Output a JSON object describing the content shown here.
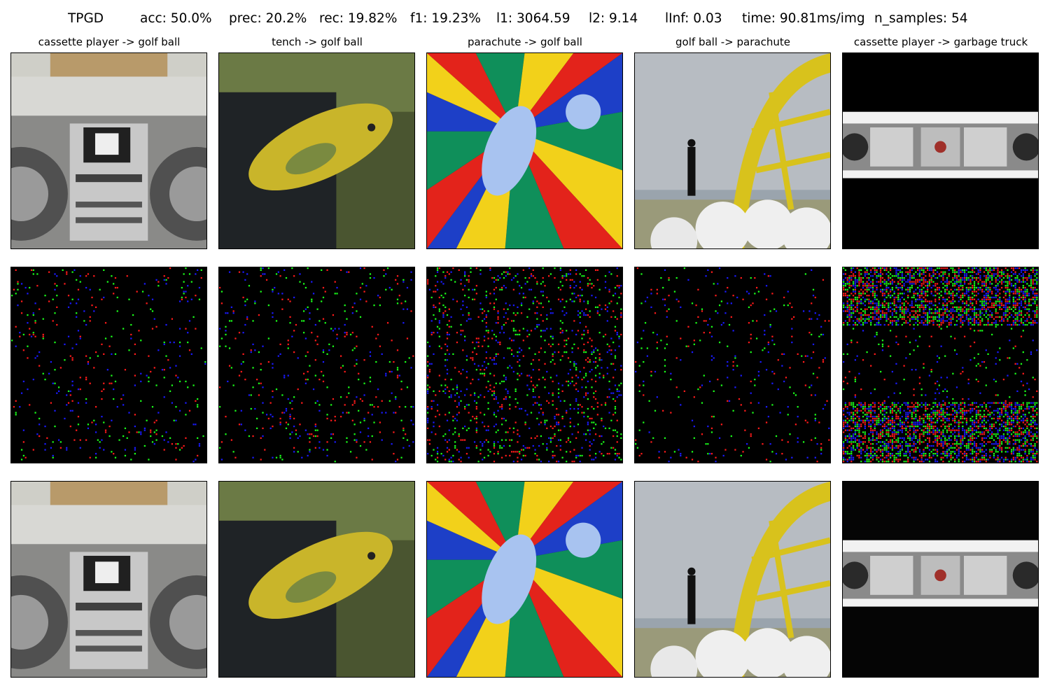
{
  "header": {
    "method": "TPGD",
    "acc": "acc: 50.0%",
    "prec": "prec: 20.2%",
    "rec": "rec: 19.82%",
    "f1": "f1: 19.23%",
    "l1": "l1: 3064.59",
    "l2": "l2: 9.14",
    "linf": "lInf: 0.03",
    "time": "time: 90.81ms/img",
    "n_samples": "n_samples: 54"
  },
  "columns": [
    {
      "title": "cassette player -> golf ball",
      "subject": "boombox-image"
    },
    {
      "title": "tench -> golf ball",
      "subject": "fish-image"
    },
    {
      "title": "parachute -> golf ball",
      "subject": "parachute-image"
    },
    {
      "title": "golf ball -> parachute",
      "subject": "golf-range-image"
    },
    {
      "title": "cassette player -> garbage truck",
      "subject": "stereo-image"
    }
  ],
  "rows": [
    "original-image",
    "perturbation-map",
    "adversarial-image"
  ],
  "colors": {
    "perturb_red": "#ff1a1a",
    "perturb_green": "#1aff1a",
    "perturb_blue": "#1a1aff",
    "background": "#000000"
  }
}
